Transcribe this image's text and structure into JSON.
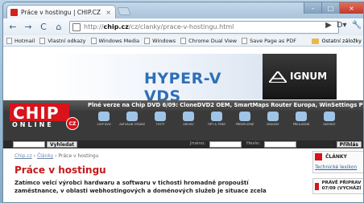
{
  "browser": {
    "tab_title": "Práce v hostingu | CHIP.CZ",
    "tab_close": "×",
    "url_prefix": "http://",
    "url_domain": "chip.cz",
    "url_path": "/cz/clanky/prace-v-hostingu.html",
    "bookmarks": [
      "Hotmail",
      "Vlastní odkazy",
      "Windows Media",
      "Windows",
      "Chrome Dual View",
      "Save Page as PDF"
    ],
    "other_bookmarks": "Ostatní záložky",
    "window_controls": [
      "–",
      "□",
      "×"
    ],
    "nav_glyphs": {
      "back": "←",
      "forward": "→",
      "reload": "C",
      "home": "⌂",
      "go": "▶",
      "page": "D▾",
      "tools": "🔧"
    }
  },
  "banner": {
    "text": "HYPER-V VDS",
    "brand": "IGNUM"
  },
  "header": {
    "promo": "Plné verze na Chip DVD 6/09: CloneDVD2 OEM, SmartMaps Router Europa, WinSettings Pro",
    "logo_top": "CHIP",
    "logo_bottom": "ONLINE",
    "logo_badge": "CZ",
    "nav_items": [
      "Chip DVD",
      "Aktuální vydání",
      "Testy",
      "Archiv",
      "Tipy & triky",
      "Předplatné",
      "Diskuse",
      "Přihlášení",
      "Inzerce"
    ]
  },
  "search": {
    "button": "Vyhledat",
    "label_name": "Jméno:",
    "label_password": "Heslo:",
    "login": "Přihlás"
  },
  "article": {
    "breadcrumb_home": "Chip.cz",
    "breadcrumb_section": "Články",
    "breadcrumb_current": "Práce v hostingu",
    "sep": "›",
    "title": "Práce v hostingu",
    "perex": "Zatímco velcí výrobci hardwaru a softwaru v tichosti hromadně propouští zaměstnance, v oblasti webhostingových a doménových služeb je situace zcela"
  },
  "sidebar": {
    "box1_title": "ČLÁNKY",
    "box1_link": "Technické lexikon",
    "box2_title": "PRÁVĚ PŘIPRAV 07/09 (VYCHÁZÍ"
  },
  "colors": {
    "chip_red": "#d8131b",
    "headline_red": "#c41a1a",
    "banner_blue": "#2f6fb6"
  }
}
